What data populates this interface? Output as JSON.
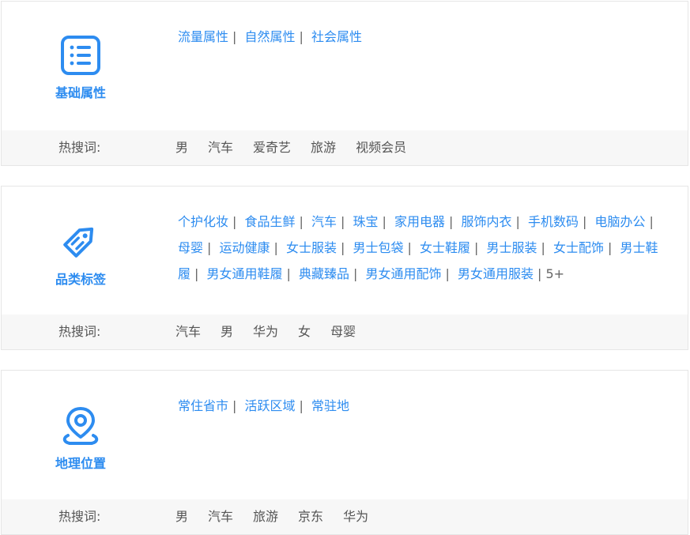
{
  "colors": {
    "accent": "#2d8cf0",
    "hot_bg": "#f7f7f7"
  },
  "sections": [
    {
      "icon": "list-icon",
      "title": "基础属性",
      "links": [
        "流量属性",
        "自然属性",
        "社会属性"
      ],
      "hot_label": "热搜词:",
      "hot_words": [
        "男",
        "汽车",
        "爱奇艺",
        "旅游",
        "视频会员"
      ]
    },
    {
      "icon": "tag-icon",
      "title": "品类标签",
      "links": [
        "个护化妆",
        "食品生鲜",
        "汽车",
        "珠宝",
        "家用电器",
        "服饰内衣",
        "手机数码",
        "电脑办公",
        "母婴",
        "运动健康",
        "女士服装",
        "男士包袋",
        "女士鞋履",
        "男士服装",
        "女士配饰",
        "男士鞋履",
        "男女通用鞋履",
        "典藏臻品",
        "男女通用配饰",
        "男女通用服装"
      ],
      "more": "5+",
      "hot_label": "热搜词:",
      "hot_words": [
        "汽车",
        "男",
        "华为",
        "女",
        "母婴"
      ]
    },
    {
      "icon": "location-pin-icon",
      "title": "地理位置",
      "links": [
        "常住省市",
        "活跃区域",
        "常驻地"
      ],
      "hot_label": "热搜词:",
      "hot_words": [
        "男",
        "汽车",
        "旅游",
        "京东",
        "华为"
      ]
    }
  ]
}
